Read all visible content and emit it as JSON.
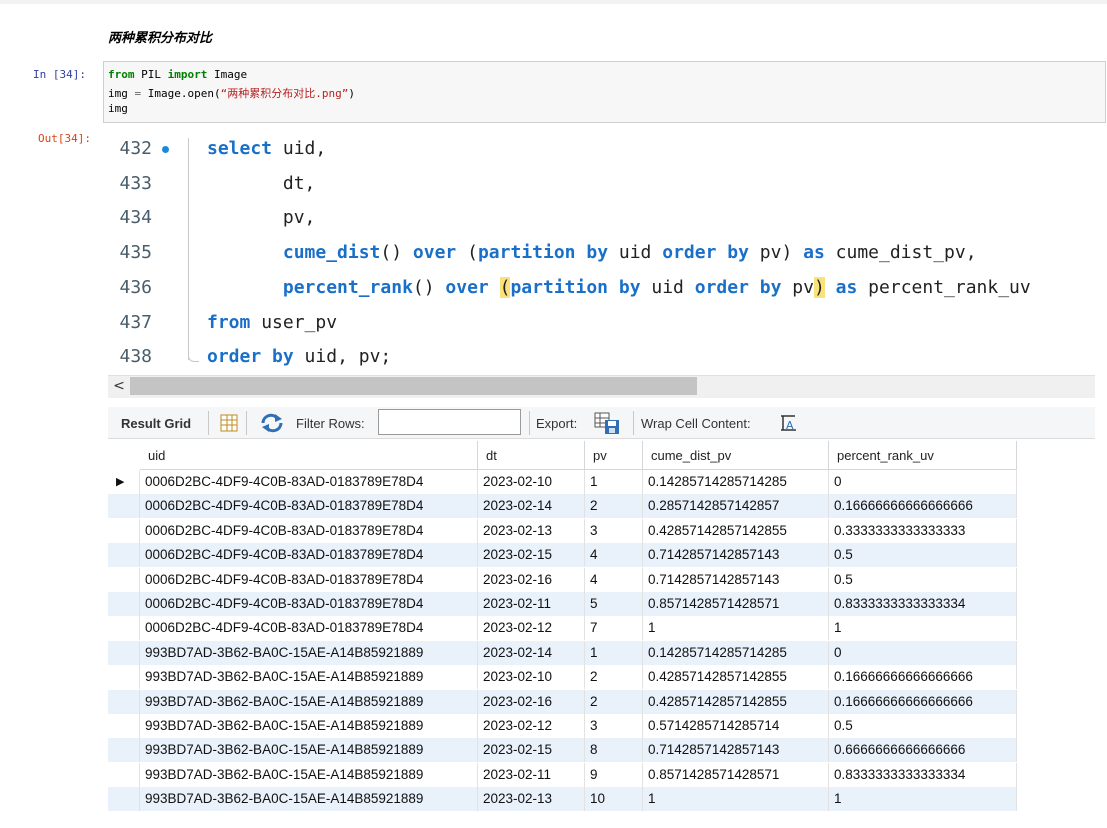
{
  "notebook": {
    "heading": "两种累积分布对比",
    "input_prompt": "In  [34]:",
    "output_prompt": "Out[34]:",
    "code": {
      "line1_kw1": "from",
      "line1_mod": " PIL ",
      "line1_kw2": "import",
      "line1_name": " Image",
      "line2_a": "img ",
      "line2_op": "=",
      "line2_b": " Image.open(",
      "line2_str": "“两种累积分布对比.png”",
      "line2_c": ")",
      "line3": "img"
    }
  },
  "sql_editor": {
    "line_numbers": [
      "432",
      "433",
      "434",
      "435",
      "436",
      "437",
      "438"
    ],
    "lines": [
      [
        {
          "t": "select",
          "k": 1
        },
        {
          "t": " uid,",
          "k": 0
        }
      ],
      [
        {
          "t": "       dt,",
          "k": 0
        }
      ],
      [
        {
          "t": "       pv,",
          "k": 0
        }
      ],
      [
        {
          "t": "       ",
          "k": 0
        },
        {
          "t": "cume_dist",
          "k": 1
        },
        {
          "t": "() ",
          "k": 0
        },
        {
          "t": "over",
          "k": 1
        },
        {
          "t": " (",
          "k": 0
        },
        {
          "t": "partition",
          "k": 1
        },
        {
          "t": " ",
          "k": 0
        },
        {
          "t": "by",
          "k": 1
        },
        {
          "t": " uid ",
          "k": 0
        },
        {
          "t": "order",
          "k": 1
        },
        {
          "t": " ",
          "k": 0
        },
        {
          "t": "by",
          "k": 1
        },
        {
          "t": " pv) ",
          "k": 0
        },
        {
          "t": "as",
          "k": 1
        },
        {
          "t": " cume_dist_pv,",
          "k": 0
        }
      ],
      [
        {
          "t": "       ",
          "k": 0
        },
        {
          "t": "percent_rank",
          "k": 1
        },
        {
          "t": "() ",
          "k": 0
        },
        {
          "t": "over",
          "k": 1
        },
        {
          "t": " ",
          "k": 0
        },
        {
          "t": "(",
          "k": 0,
          "h": 1
        },
        {
          "t": "partition",
          "k": 1
        },
        {
          "t": " ",
          "k": 0
        },
        {
          "t": "by",
          "k": 1
        },
        {
          "t": " uid ",
          "k": 0
        },
        {
          "t": "order",
          "k": 1
        },
        {
          "t": " ",
          "k": 0
        },
        {
          "t": "by",
          "k": 1
        },
        {
          "t": " pv",
          "k": 0
        },
        {
          "t": ")",
          "k": 0,
          "h": 1
        },
        {
          "t": " ",
          "k": 0
        },
        {
          "t": "as",
          "k": 1
        },
        {
          "t": " percent_rank_uv",
          "k": 0
        }
      ],
      [
        {
          "t": "from",
          "k": 1
        },
        {
          "t": " user_pv",
          "k": 0
        }
      ],
      [
        {
          "t": "order",
          "k": 1
        },
        {
          "t": " ",
          "k": 0
        },
        {
          "t": "by",
          "k": 1
        },
        {
          "t": " uid, pv;",
          "k": 0
        }
      ]
    ]
  },
  "scrollbar": {
    "left_arrow": "<"
  },
  "toolbar": {
    "result_grid": "Result Grid",
    "filter_rows": "Filter Rows:",
    "filter_value": "",
    "export": "Export:",
    "wrap": "Wrap Cell Content:"
  },
  "grid": {
    "columns": [
      "uid",
      "dt",
      "pv",
      "cume_dist_pv",
      "percent_rank_uv"
    ],
    "current_row_marker": "▶",
    "rows": [
      [
        "0006D2BC-4DF9-4C0B-83AD-0183789E78D4",
        "2023-02-10",
        "1",
        "0.14285714285714285",
        "0"
      ],
      [
        "0006D2BC-4DF9-4C0B-83AD-0183789E78D4",
        "2023-02-14",
        "2",
        "0.2857142857142857",
        "0.16666666666666666"
      ],
      [
        "0006D2BC-4DF9-4C0B-83AD-0183789E78D4",
        "2023-02-13",
        "3",
        "0.42857142857142855",
        "0.3333333333333333"
      ],
      [
        "0006D2BC-4DF9-4C0B-83AD-0183789E78D4",
        "2023-02-15",
        "4",
        "0.7142857142857143",
        "0.5"
      ],
      [
        "0006D2BC-4DF9-4C0B-83AD-0183789E78D4",
        "2023-02-16",
        "4",
        "0.7142857142857143",
        "0.5"
      ],
      [
        "0006D2BC-4DF9-4C0B-83AD-0183789E78D4",
        "2023-02-11",
        "5",
        "0.8571428571428571",
        "0.8333333333333334"
      ],
      [
        "0006D2BC-4DF9-4C0B-83AD-0183789E78D4",
        "2023-02-12",
        "7",
        "1",
        "1"
      ],
      [
        "993BD7AD-3B62-BA0C-15AE-A14B85921889",
        "2023-02-14",
        "1",
        "0.14285714285714285",
        "0"
      ],
      [
        "993BD7AD-3B62-BA0C-15AE-A14B85921889",
        "2023-02-10",
        "2",
        "0.42857142857142855",
        "0.16666666666666666"
      ],
      [
        "993BD7AD-3B62-BA0C-15AE-A14B85921889",
        "2023-02-16",
        "2",
        "0.42857142857142855",
        "0.16666666666666666"
      ],
      [
        "993BD7AD-3B62-BA0C-15AE-A14B85921889",
        "2023-02-12",
        "3",
        "0.5714285714285714",
        "0.5"
      ],
      [
        "993BD7AD-3B62-BA0C-15AE-A14B85921889",
        "2023-02-15",
        "8",
        "0.7142857142857143",
        "0.6666666666666666"
      ],
      [
        "993BD7AD-3B62-BA0C-15AE-A14B85921889",
        "2023-02-11",
        "9",
        "0.8571428571428571",
        "0.8333333333333334"
      ],
      [
        "993BD7AD-3B62-BA0C-15AE-A14B85921889",
        "2023-02-13",
        "10",
        "1",
        "1"
      ]
    ]
  }
}
